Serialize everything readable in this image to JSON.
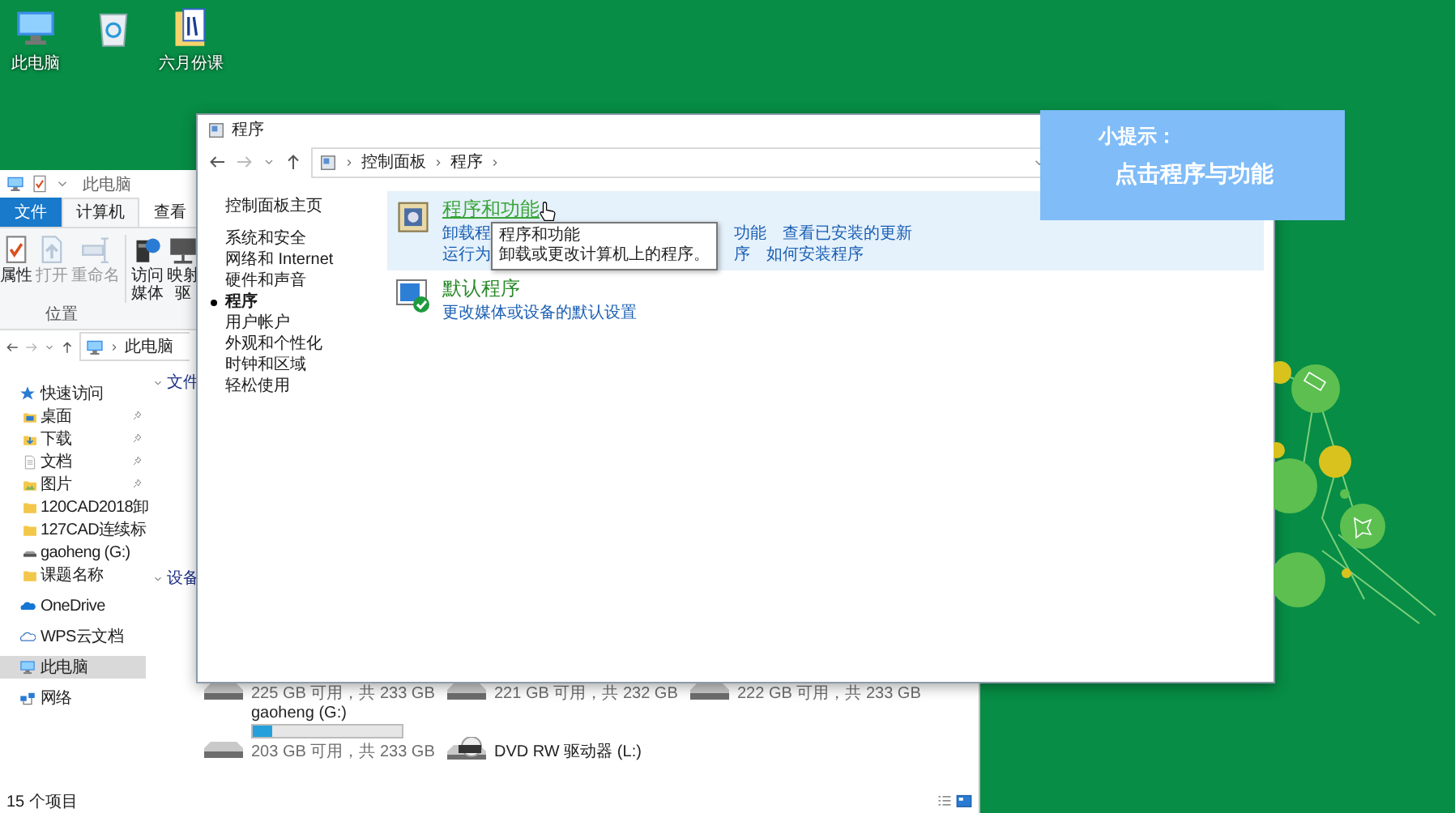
{
  "desktop": {
    "icons": [
      {
        "kind": "computer",
        "label": "此电脑"
      },
      {
        "kind": "recycle-bin"
      },
      {
        "kind": "document-folder",
        "label": "六月份课"
      }
    ]
  },
  "explorer": {
    "title": "此电脑",
    "ribbon_tabs": [
      {
        "kind": "file",
        "label": "文件",
        "selected": false
      },
      {
        "kind": "tab",
        "label": "计算机",
        "selected": true
      },
      {
        "kind": "tab",
        "label": "查看",
        "selected": false
      }
    ],
    "ribbon_buttons": [
      {
        "kind": "properties",
        "label": "属性",
        "disabled": false
      },
      {
        "kind": "open",
        "label": "打开",
        "disabled": true
      },
      {
        "kind": "rename",
        "label": "重命名",
        "disabled": true
      },
      {
        "kind": "media",
        "label": "访问媒体",
        "disabled": false
      },
      {
        "kind": "map-drive",
        "label": "映射驱",
        "disabled": false
      }
    ],
    "ribbon_group": "位置",
    "address": "此电脑",
    "nav": [
      {
        "kind": "star",
        "label": "快速访问",
        "selected": false,
        "children": [
          {
            "kind": "desktop",
            "label": "桌面",
            "pinned": true,
            "selected": false
          },
          {
            "kind": "download",
            "label": "下载",
            "pinned": true,
            "selected": false
          },
          {
            "kind": "document",
            "label": "文档",
            "pinned": true,
            "selected": false
          },
          {
            "kind": "picture",
            "label": "图片",
            "pinned": true,
            "selected": false
          },
          {
            "kind": "folder",
            "label": "120CAD2018卸",
            "pinned": false,
            "selected": false
          },
          {
            "kind": "folder",
            "label": "127CAD连续标",
            "pinned": false,
            "selected": false
          },
          {
            "kind": "drive",
            "label": "gaoheng (G:)",
            "pinned": false,
            "selected": false
          },
          {
            "kind": "folder",
            "label": "课题名称",
            "pinned": false,
            "selected": false
          }
        ]
      },
      {
        "kind": "onedrive",
        "label": "OneDrive",
        "selected": false
      },
      {
        "kind": "wps-cloud",
        "label": "WPS云文档",
        "selected": false
      },
      {
        "kind": "computer",
        "label": "此电脑",
        "selected": true
      },
      {
        "kind": "network",
        "label": "网络",
        "selected": false
      }
    ],
    "sections": [
      "文件",
      "设备"
    ],
    "drives": [
      {
        "kind": "hdd",
        "free": "225 GB 可用，共 233 GB"
      },
      {
        "kind": "hdd",
        "free": "221 GB 可用，共 232 GB"
      },
      {
        "kind": "hdd",
        "free": "222 GB 可用，共 233 GB"
      },
      {
        "kind": "hdd",
        "name": "gaoheng (G:)",
        "level": 0.13,
        "free": "203 GB 可用，共 233 GB"
      },
      {
        "kind": "dvd",
        "name": "DVD RW 驱动器 (L:)"
      }
    ],
    "status": "15 个项目"
  },
  "control_panel": {
    "title": "程序",
    "breadcrumbs": [
      "控制面板",
      "程序"
    ],
    "nav": [
      {
        "label": "控制面板主页",
        "selected": false
      },
      {
        "label": "系统和安全",
        "selected": false
      },
      {
        "label": "网络和 Internet",
        "selected": false
      },
      {
        "label": "硬件和声音",
        "selected": false
      },
      {
        "label": "程序",
        "selected": true
      },
      {
        "label": "用户帐户",
        "selected": false
      },
      {
        "label": "外观和个性化",
        "selected": false
      },
      {
        "label": "时钟和区域",
        "selected": false
      },
      {
        "label": "轻松使用",
        "selected": false
      }
    ],
    "categories": [
      {
        "kind": "programs",
        "title": "程序和功能",
        "highlighted": true,
        "link_rows": [
          [
            "卸载程",
            "功能",
            "查看已安装的更新"
          ],
          [
            "运行为",
            "序",
            "如何安装程序"
          ]
        ]
      },
      {
        "kind": "default-programs",
        "title": "默认程序",
        "highlighted": false,
        "link_rows": [
          [
            "更改媒体或设备的默认设置"
          ]
        ]
      }
    ],
    "tooltip": {
      "title": "程序和功能",
      "text": "卸载或更改计算机上的程序。"
    }
  },
  "tip": {
    "title": "小提示：",
    "text": "点击程序与功能"
  }
}
